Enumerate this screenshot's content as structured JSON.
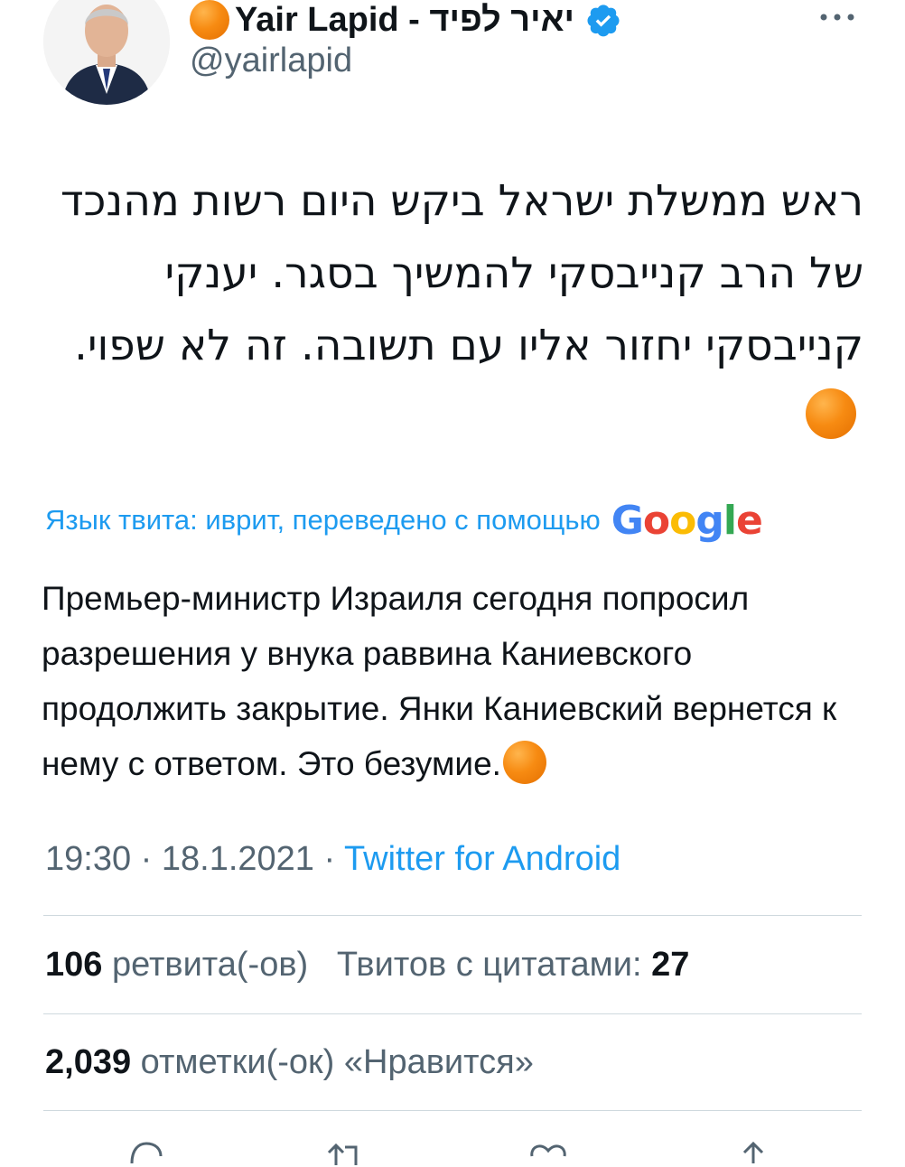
{
  "author": {
    "display_name": "Yair Lapid - יאיר לפיד",
    "handle": "@yairlapid",
    "verified": true,
    "avatar_icon": "avatar-photo",
    "emoji_icon": "orange-circle-icon"
  },
  "tweet": {
    "hebrew_text": "ראש ממשלת ישראל ביקש היום רשות מהנכד של הרב קנייבסקי להמשיך בסגר. יענקי קנייבסקי יחזור אליו עם תשובה. זה לא שפוי.",
    "translation_label": "Язык твита: иврит, переведено с помощью",
    "translation_provider": [
      "G",
      "o",
      "o",
      "g",
      "l",
      "e"
    ],
    "translated_text": "Премьер-министр Израиля сегодня попросил разрешения у внука раввина Каниевского продолжить закрытие. Янки Каниевский вернется к нему с ответом. Это безумие."
  },
  "meta": {
    "time": "19:30",
    "separator": " · ",
    "date": "18.1.2021",
    "source": "Twitter for Android"
  },
  "stats": {
    "retweets_count": "106",
    "retweets_label": "ретвита(-ов)",
    "quotes_label": "Твитов с цитатами:",
    "quotes_count": "27",
    "likes_count": "2,039",
    "likes_label": "отметки(-ок) «Нравится»"
  },
  "colors": {
    "link_blue": "#1d9bf0",
    "secondary_text": "#536471",
    "primary_text": "#0f1419",
    "divider": "#cfd9de",
    "emoji_orange": "#f78b12"
  },
  "icons": [
    "more-icon",
    "verified-badge-icon",
    "reply-icon",
    "retweet-icon",
    "like-icon",
    "share-icon"
  ]
}
